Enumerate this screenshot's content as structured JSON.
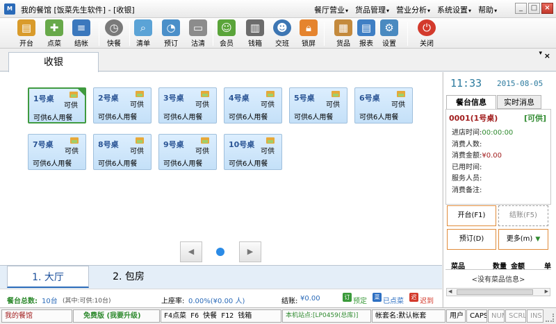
{
  "window": {
    "title": "我的餐馆 [饭菜先生软件] - [收银]",
    "logo": "M",
    "menu": [
      "餐厅营业",
      "货品管理",
      "营业分析",
      "系统设置",
      "帮助"
    ],
    "controls": [
      "_",
      "□",
      "×"
    ]
  },
  "toolbar": {
    "buttons": [
      {
        "id": "open-table",
        "label": "开台",
        "icon": "open-table-icon",
        "color": "#d99b2b"
      },
      {
        "id": "order",
        "label": "点菜",
        "icon": "order-icon",
        "color": "#68a94a"
      },
      {
        "id": "checkout",
        "label": "结帐",
        "icon": "checkout-icon",
        "color": "#3b78bd"
      },
      {
        "id": "fast-food",
        "label": "快餐",
        "icon": "clock-icon",
        "color": "#7a7a7a"
      },
      {
        "id": "order-list",
        "label": "清单",
        "icon": "list-icon",
        "color": "#5ba3d6"
      },
      {
        "id": "reserve",
        "label": "预订",
        "icon": "reserve-icon",
        "color": "#4a8fc9"
      },
      {
        "id": "clear",
        "label": "沽清",
        "icon": "clipboard-icon",
        "color": "#8c8c8c"
      },
      {
        "id": "member",
        "label": "会员",
        "icon": "member-icon",
        "color": "#5aa43a"
      },
      {
        "id": "cashbox",
        "label": "钱箱",
        "icon": "cashbox-icon",
        "color": "#6c6c6c"
      },
      {
        "id": "shift",
        "label": "交班",
        "icon": "shift-icon",
        "color": "#3d76b3"
      },
      {
        "id": "lock",
        "label": "锁屏",
        "icon": "lock-icon",
        "color": "#e5842e"
      },
      {
        "id": "goods",
        "label": "货品",
        "icon": "goods-icon",
        "color": "#c48a3d"
      },
      {
        "id": "report",
        "label": "报表",
        "icon": "report-icon",
        "color": "#3f7fc4"
      },
      {
        "id": "settings",
        "label": "设置",
        "icon": "settings-icon",
        "color": "#4a8ac0"
      },
      {
        "id": "close",
        "label": "关闭",
        "icon": "power-icon",
        "color": "#d33a2c"
      }
    ]
  },
  "tabs": {
    "active": "收银",
    "close": "×",
    "pin": "▾"
  },
  "tables": [
    {
      "name": "1号桌",
      "status": "可供",
      "capacity": "可供6人用餐",
      "selected": true
    },
    {
      "name": "2号桌",
      "status": "可供",
      "capacity": "可供6人用餐"
    },
    {
      "name": "3号桌",
      "status": "可供",
      "capacity": "可供6人用餐"
    },
    {
      "name": "4号桌",
      "status": "可供",
      "capacity": "可供6人用餐"
    },
    {
      "name": "5号桌",
      "status": "可供",
      "capacity": "可供6人用餐"
    },
    {
      "name": "6号桌",
      "status": "可供",
      "capacity": "可供6人用餐"
    },
    {
      "name": "7号桌",
      "status": "可供",
      "capacity": "可供6人用餐"
    },
    {
      "name": "8号桌",
      "status": "可供",
      "capacity": "可供6人用餐"
    },
    {
      "name": "9号桌",
      "status": "可供",
      "capacity": "可供6人用餐"
    },
    {
      "name": "10号桌",
      "status": "可供",
      "capacity": "可供6人用餐"
    }
  ],
  "pager": {
    "prev": "◀",
    "next": "▶"
  },
  "area_tabs": [
    "1. 大厅",
    "2. 包房"
  ],
  "infobar": {
    "total_label": "餐台总数:",
    "total_value": "10台",
    "total_detail": "(其中:可供:10台)",
    "rate_label": "上座率:",
    "rate_value": "0.00%(¥0.00 人)",
    "checkout_label": "结账:",
    "checkout_value": "¥0.00",
    "legend": [
      {
        "glyph": "订",
        "label": "预定",
        "color": "#3a9a3a"
      },
      {
        "glyph": "菜",
        "label": "已点菜",
        "color": "#2d6fc2"
      },
      {
        "glyph": "迟",
        "label": "迟到",
        "color": "#d33a2c"
      }
    ]
  },
  "right_panel": {
    "clock": "11:33",
    "date": "2015-08-05",
    "tabs": [
      "餐台信息",
      "实时消息"
    ],
    "table_id": "0001(1号桌)",
    "table_status": "[可供]",
    "rows": [
      {
        "label": "进店时间:",
        "value": "00:00:00"
      },
      {
        "label": "消费人数:",
        "value": ""
      },
      {
        "label": "消费金额:",
        "value": "¥0.00"
      },
      {
        "label": "已用时间:",
        "value": ""
      },
      {
        "label": "服务人员:",
        "value": ""
      },
      {
        "label": "消费备注:",
        "value": ""
      }
    ],
    "btn_open": "开台(F1)",
    "btn_checkout": "结账(F5)",
    "btn_reserve": "预订(D)",
    "btn_more": "更多(m)",
    "dish_cols": [
      "菜品",
      "数量",
      "金额",
      "单"
    ],
    "dish_empty": "<没有菜品信息>"
  },
  "statusbar": {
    "shop": "我的餐馆",
    "edition": "免费版 (我要升级)",
    "shortcuts": "F4点菜  F6 快餐   F12 钱箱",
    "station": "本机站点:[LP0459(总库)]",
    "account": "帐套名:默认帐套",
    "user": "用户",
    "caps": "CAPS",
    "num": "NUM",
    "scrl": "SCRL",
    "ins": "INS"
  },
  "colors": {
    "accent": "#2a6ab8",
    "green": "#2f8a2f",
    "red": "#a11d1d",
    "orange": "#e08b3a"
  }
}
